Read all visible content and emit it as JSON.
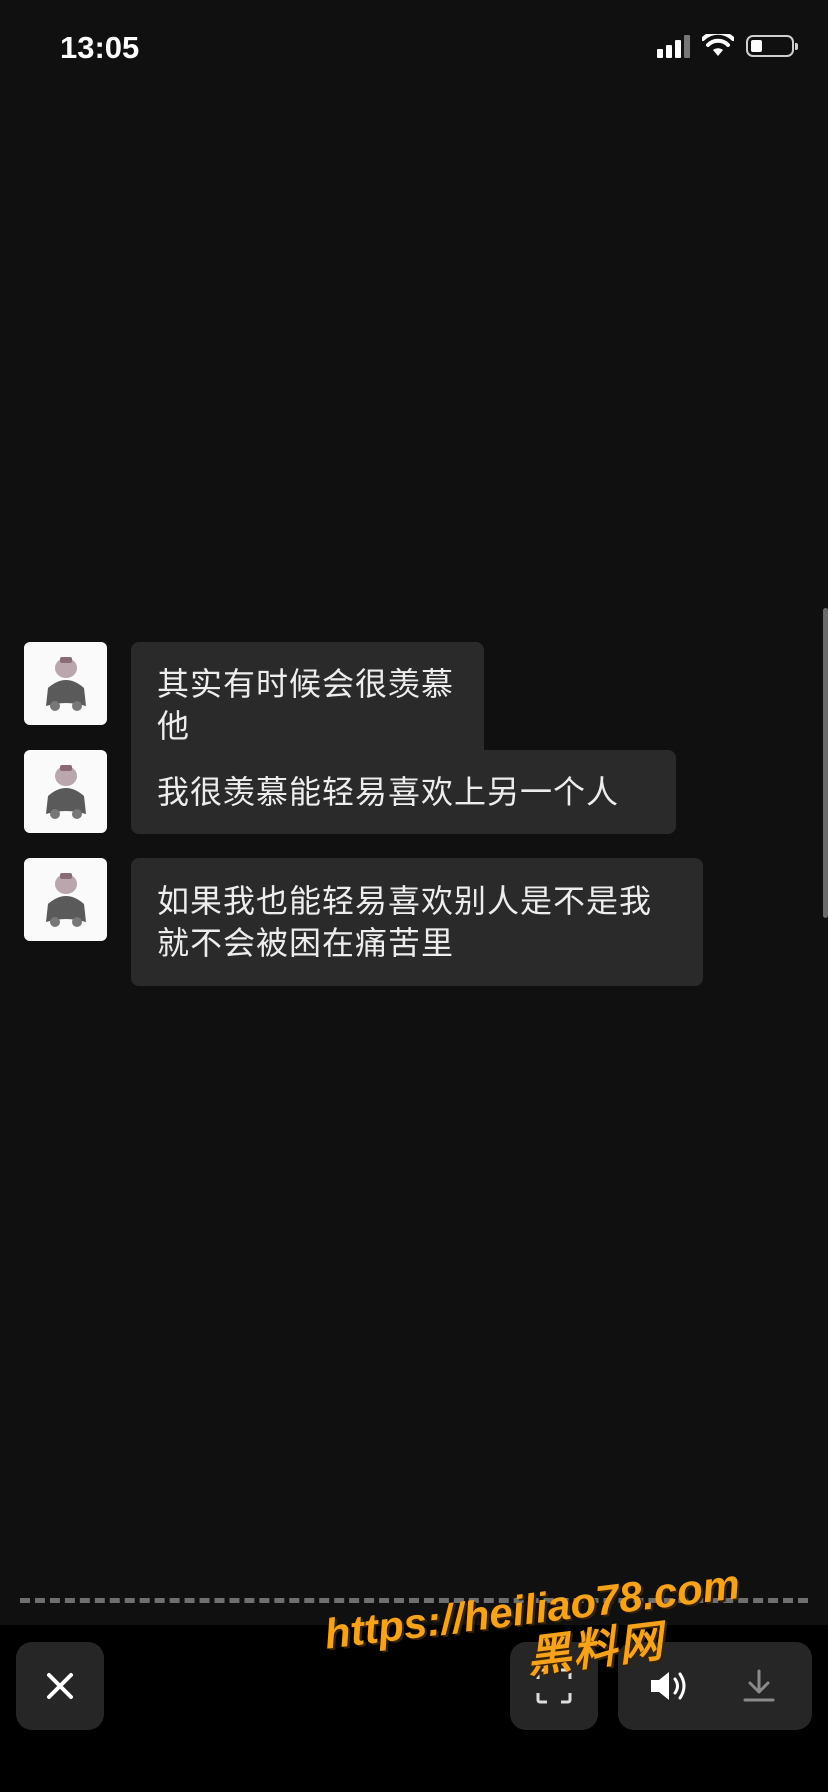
{
  "status_bar": {
    "time": "13:05"
  },
  "messages": [
    {
      "text": "其实有时候会很羡慕他"
    },
    {
      "text": "我很羡慕能轻易喜欢上另一个人"
    },
    {
      "text": "如果我也能轻易喜欢别人是不是我就不会被困在痛苦里"
    }
  ],
  "toolbar": {
    "close_icon": "close-icon",
    "scan_icon": "scan-icon",
    "sound_icon": "speaker-icon",
    "download_icon": "download-icon"
  },
  "watermark": {
    "url": "https://heiliao78.com",
    "label": "黑料网"
  },
  "colors": {
    "background": "#101010",
    "bubble": "#2a2a2a",
    "watermark": "#f7a21b"
  }
}
